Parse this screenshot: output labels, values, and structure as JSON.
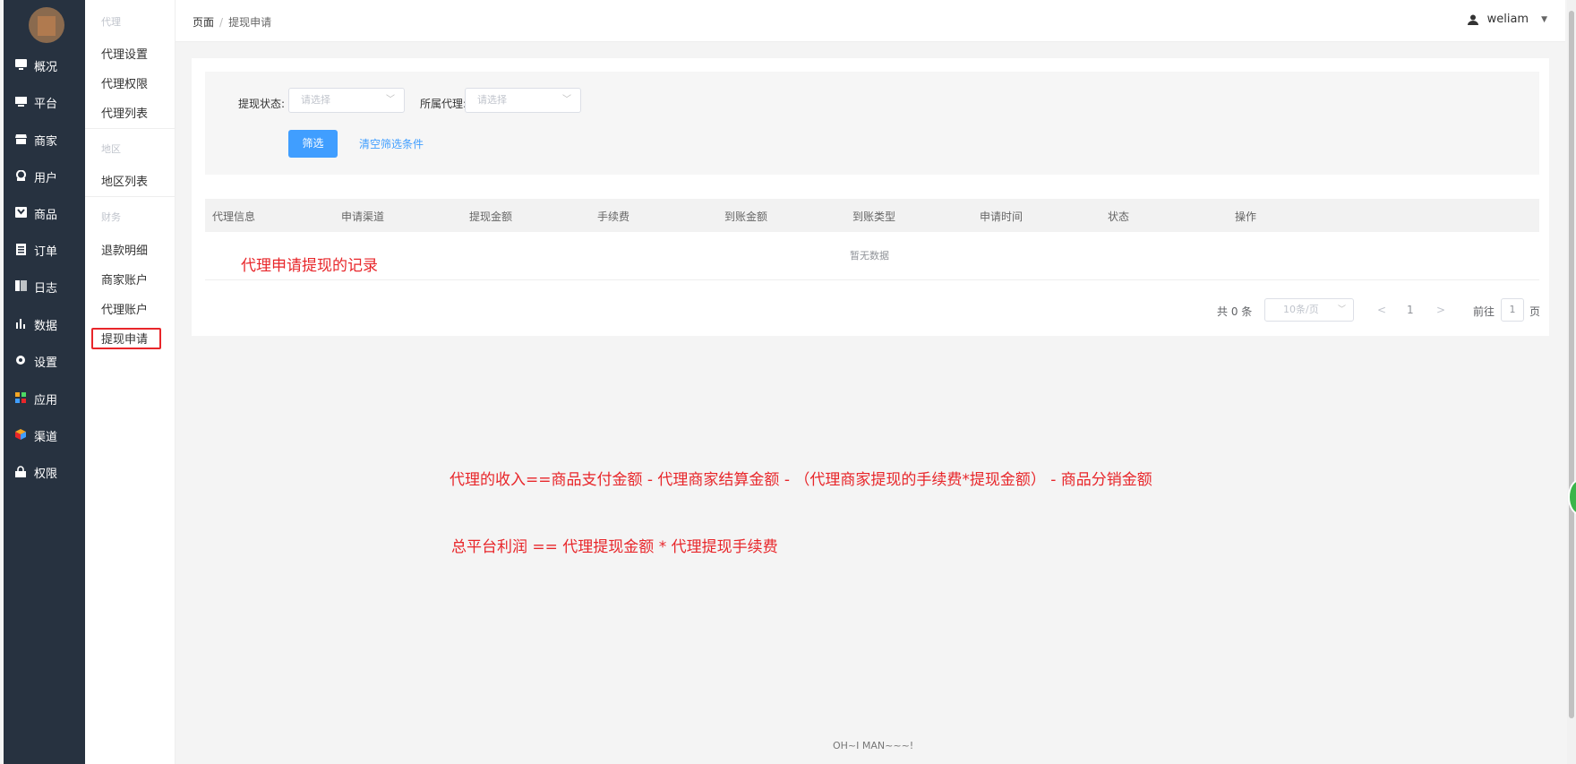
{
  "main_nav": {
    "items": [
      {
        "label": "概况",
        "icon": "monitor-icon"
      },
      {
        "label": "平台",
        "icon": "desktop-icon"
      },
      {
        "label": "商家",
        "icon": "store-icon"
      },
      {
        "label": "用户",
        "icon": "user-icon"
      },
      {
        "label": "商品",
        "icon": "goods-icon"
      },
      {
        "label": "订单",
        "icon": "order-icon"
      },
      {
        "label": "日志",
        "icon": "log-icon"
      },
      {
        "label": "数据",
        "icon": "bar-chart-icon"
      },
      {
        "label": "设置",
        "icon": "gear-icon"
      },
      {
        "label": "应用",
        "icon": "apps-grid-icon"
      },
      {
        "label": "渠道",
        "icon": "cube-icon"
      },
      {
        "label": "权限",
        "icon": "lock-icon"
      }
    ]
  },
  "sub_nav": {
    "group_agent": "代理",
    "agent_items": [
      "代理设置",
      "代理权限",
      "代理列表"
    ],
    "group_region": "地区",
    "region_items": [
      "地区列表"
    ],
    "group_finance": "财务",
    "finance_items": [
      "退款明细",
      "商家账户",
      "代理账户",
      "提现申请"
    ]
  },
  "header": {
    "crumb_root": "页面",
    "crumb_sep": "/",
    "crumb_current": "提现申请",
    "username": "weliam"
  },
  "filter": {
    "status_label": "提现状态:",
    "status_placeholder": "请选择",
    "agent_label": "所属代理:",
    "agent_placeholder": "请选择",
    "submit_label": "筛选",
    "clear_label": "清空筛选条件"
  },
  "table": {
    "columns": [
      "代理信息",
      "申请渠道",
      "提现金额",
      "手续费",
      "到账金额",
      "到账类型",
      "申请时间",
      "状态",
      "操作"
    ],
    "empty_text": "暂无数据",
    "annotation": "代理申请提现的记录"
  },
  "pagination": {
    "total": "共 0 条",
    "page_size": "10条/页",
    "prev": "<",
    "current": "1",
    "next": ">",
    "goto_label": "前往",
    "goto_value": "1",
    "page_suffix": "页"
  },
  "notes": {
    "formula1": "代理的收入==商品支付金额 - 代理商家结算金额 - （代理商家提现的手续费*提现金额） - 商品分销金额",
    "formula2": "总平台利润 ==  代理提现金额  *  代理提现手续费"
  },
  "footer": "OH~I MAN~~~!",
  "colors": {
    "sidebar_bg": "#273240",
    "primary": "#409eff",
    "annotation_red": "#e8262a"
  }
}
